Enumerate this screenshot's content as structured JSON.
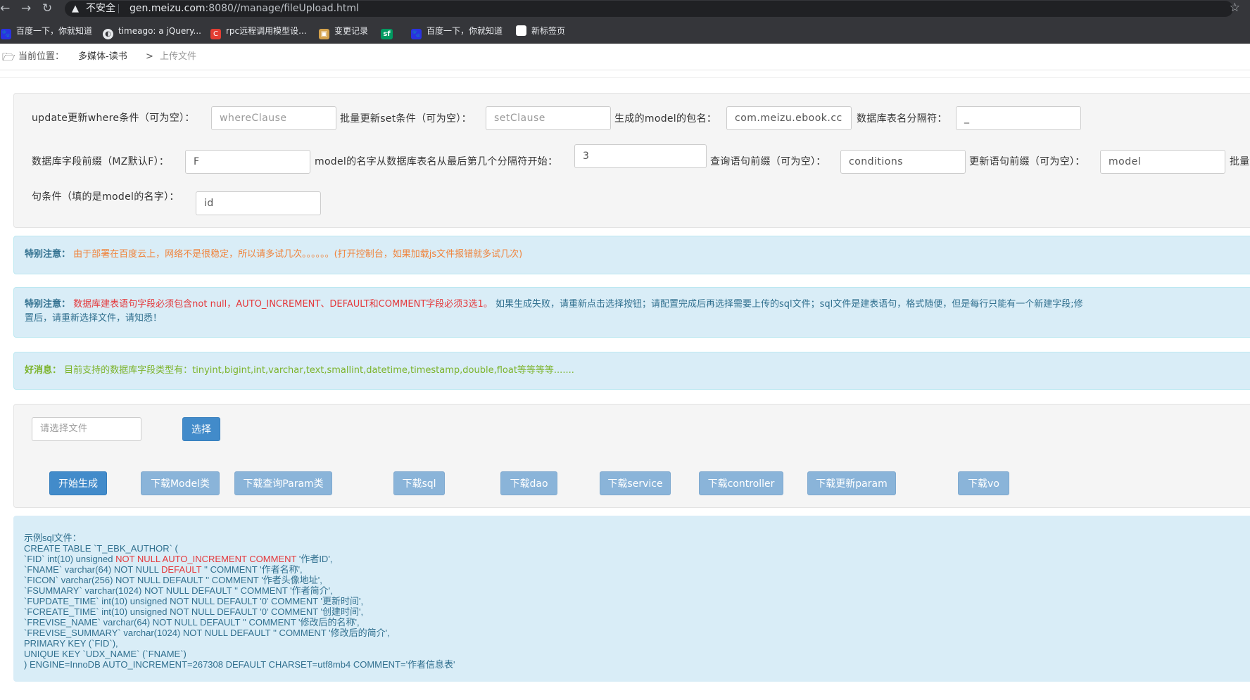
{
  "browser": {
    "insecure_label": "不安全",
    "url_host": "gen.meizu.com",
    "url_rest": ":8080//manage/fileUpload.html",
    "bookmarks": [
      {
        "label": "百度一下，你就知道",
        "icon": "baidu-icon",
        "color": "#2932e1"
      },
      {
        "label": "timeago: a jQuery...",
        "icon": "globe-icon",
        "color": "#e8eaed"
      },
      {
        "label": "rpc远程调用模型设...",
        "icon": "csdn-icon",
        "color": "#e33e33"
      },
      {
        "label": "变更记录",
        "icon": "image-icon",
        "color": "#d4a24c"
      },
      {
        "label": "sf",
        "icon": "segmentfault-icon",
        "color": "#009a61"
      },
      {
        "label": "百度一下，你就知道",
        "icon": "baidu-icon",
        "color": "#2932e1"
      },
      {
        "label": "新标签页",
        "icon": "page-icon",
        "color": "#ffffff"
      }
    ]
  },
  "breadcrumb": {
    "label": "当前位置：",
    "parent": "多媒体-读书",
    "separator": ">",
    "current": "上传文件"
  },
  "form": {
    "where_label": "update更新where条件（可为空）：",
    "where_placeholder": "whereClause",
    "set_label": "批量更新set条件（可为空）：",
    "set_placeholder": "setClause",
    "package_label": "生成的model的包名：",
    "package_value": "com.meizu.ebook.cc",
    "separator_label": "数据库表名分隔符：",
    "separator_value": "_",
    "prefix_label": "数据库字段前缀（MZ默认F）：",
    "prefix_value": "F",
    "model_index_label": "model的名字从数据库表名从最后第几个分隔符开始：",
    "model_index_value": "3",
    "query_prefix_label": "查询语句前缀（可为空）：",
    "query_prefix_value": "conditions",
    "update_prefix_label": "更新语句前缀（可为空）：",
    "update_prefix_value": "model",
    "batch_label_cut": "批量",
    "where_model_label": "句条件（填的是model的名字）：",
    "where_model_value": "id"
  },
  "notices": {
    "notice1_tag": "特别注意：",
    "notice1_text": "由于部署在百度云上，网络不是很稳定，所以请多试几次。。。。。。(打开控制台，如果加载js文件报错就多试几次)",
    "notice2_tag": "特别注意：",
    "notice2_red": "数据库建表语句字段必须包含not null，AUTO_INCREMENT、DEFAULT和COMMENT字段必须3选1。",
    "notice2_text": "如果生成失败，请重新点击选择按钮；请配置完成后再选择需要上传的sql文件；sql文件是建表语句，格式随便，但是每行只能有一个新建字段;修",
    "notice2_text2": "置后，请重新选择文件，请知悉！",
    "notice3_tag": "好消息：",
    "notice3_text": "目前支持的数据库字段类型有：tinyint,bigint,int,varchar,text,smallint,datetime,timestamp,double,float等等等等......."
  },
  "upload": {
    "file_placeholder": "请选择文件",
    "choose_label": "选择"
  },
  "actions": {
    "generate": "开始生成",
    "download_model": "下载Model类",
    "download_query_param": "下载查询Param类",
    "download_sql": "下载sql",
    "download_dao": "下载dao",
    "download_service": "下载service",
    "download_controller": "下载controller",
    "download_update_param": "下载更新param",
    "download_vo": "下载vo"
  },
  "sql_example": {
    "title": "示例sql文件：",
    "line1": "CREATE TABLE `T_EBK_AUTHOR` (",
    "line2_a": "`FID` int(10) unsigned ",
    "line2_b": "NOT NULL AUTO_INCREMENT COMMENT",
    "line2_c": " '作者ID',",
    "line3_a": "`FNAME` varchar(64) NOT NULL ",
    "line3_b": "DEFAULT",
    "line3_c": " '' COMMENT '作者名称',",
    "line4": "`FICON` varchar(256) NOT NULL DEFAULT '' COMMENT '作者头像地址',",
    "line5": "`FSUMMARY` varchar(1024) NOT NULL DEFAULT '' COMMENT '作者简介',",
    "line6": "`FUPDATE_TIME` int(10) unsigned NOT NULL DEFAULT '0' COMMENT '更新时间',",
    "line7": "`FCREATE_TIME` int(10) unsigned NOT NULL DEFAULT '0' COMMENT '创建时间',",
    "line8": "`FREVISE_NAME` varchar(64) NOT NULL DEFAULT '' COMMENT '修改后的名称',",
    "line9": "`FREVISE_SUMMARY` varchar(1024) NOT NULL DEFAULT '' COMMENT '修改后的简介',",
    "line10": "PRIMARY KEY (`FID`),",
    "line11": "UNIQUE KEY `UDX_NAME` (`FNAME`)",
    "line12": ") ENGINE=InnoDB AUTO_INCREMENT=267308 DEFAULT CHARSET=utf8mb4 COMMENT='作者信息表'"
  }
}
